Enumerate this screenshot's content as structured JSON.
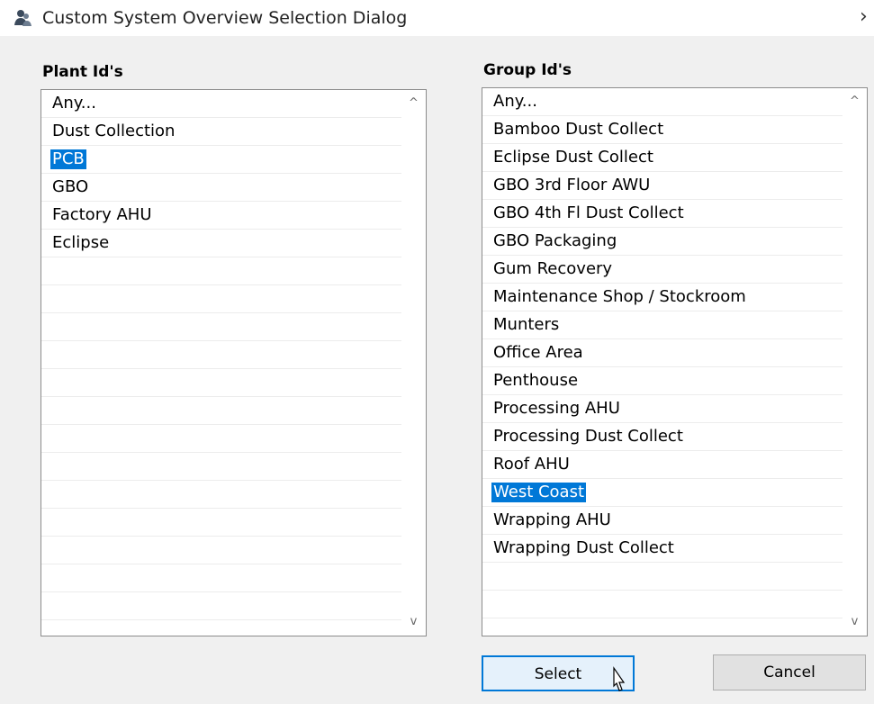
{
  "window": {
    "title": "Custom System Overview Selection Dialog",
    "close_glyph": "›",
    "icon": "people-icon"
  },
  "plant_panel": {
    "label": "Plant Id's",
    "items": [
      "Any...",
      "Dust Collection",
      "PCB",
      "GBO",
      "Factory AHU",
      "Eclipse"
    ],
    "selected": "PCB"
  },
  "group_panel": {
    "label": "Group Id's",
    "items": [
      "Any...",
      "Bamboo Dust Collect",
      "Eclipse Dust Collect",
      "GBO 3rd Floor AWU",
      "GBO 4th Fl Dust Collect",
      "GBO Packaging",
      "Gum Recovery",
      "Maintenance Shop / Stockroom",
      "Munters",
      "Office Area",
      "Penthouse",
      "Processing AHU",
      "Processing Dust Collect",
      "Roof AHU",
      "West Coast",
      "Wrapping AHU",
      "Wrapping Dust Collect"
    ],
    "selected": "West Coast"
  },
  "scroll": {
    "up_glyph": "^",
    "down_glyph": "v"
  },
  "buttons": {
    "select": "Select",
    "cancel": "Cancel"
  },
  "colors": {
    "selection": "#0078d7",
    "background": "#f0f0f0"
  }
}
